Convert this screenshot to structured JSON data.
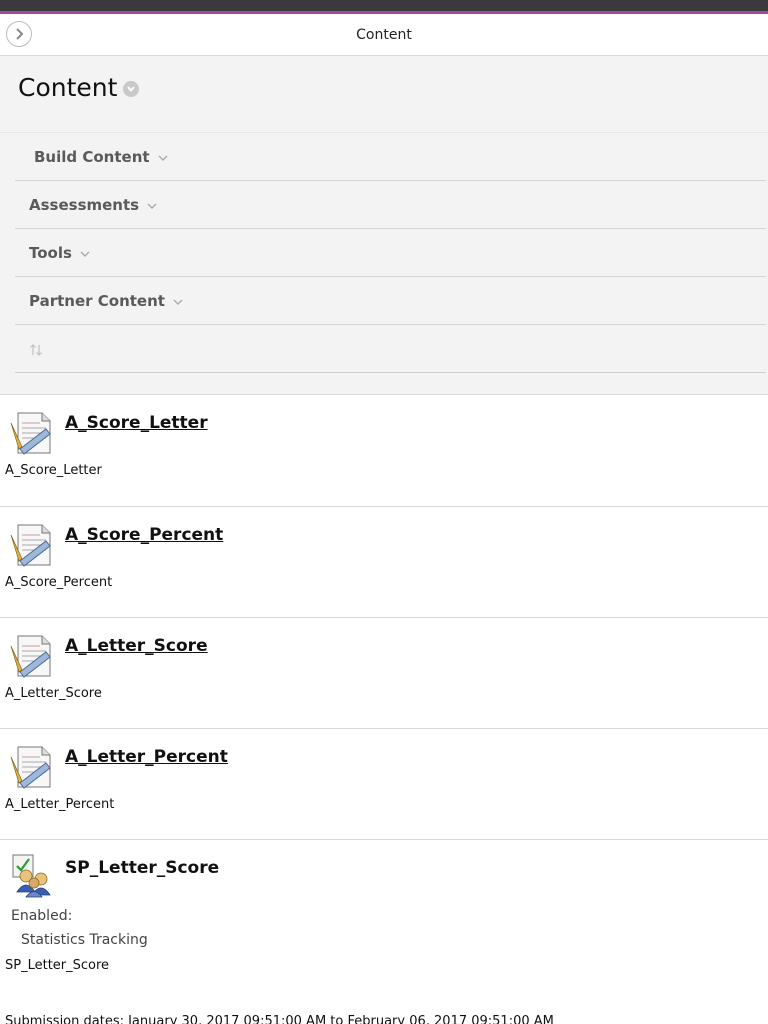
{
  "header": {
    "nav_title": "Content",
    "page_title": "Content"
  },
  "menu": {
    "items": [
      {
        "label": "Build Content"
      },
      {
        "label": "Assessments"
      },
      {
        "label": "Tools"
      },
      {
        "label": "Partner Content"
      }
    ]
  },
  "content_items": [
    {
      "title": "A_Score_Letter",
      "description": "A_Score_Letter",
      "icon": "assignment-icon"
    },
    {
      "title": "A_Score_Percent",
      "description": "A_Score_Percent",
      "icon": "assignment-icon"
    },
    {
      "title": "A_Letter_Score",
      "description": "A_Letter_Score",
      "icon": "assignment-icon"
    },
    {
      "title": "A_Letter_Percent",
      "description": "A_Letter_Percent",
      "icon": "assignment-icon"
    }
  ],
  "survey_item": {
    "title": "SP_Letter_Score",
    "icon": "self-peer-assessment-icon",
    "enabled_label": "Enabled:",
    "enabled_value": "Statistics Tracking",
    "description": "SP_Letter_Score",
    "submission_dates": "Submission dates: January 30, 2017 09:51:00 AM to February 06, 2017 09:51:00 AM"
  },
  "colors": {
    "topbar": "#3a393d",
    "accent": "#a24a9f",
    "panel_bg": "#f3f3f3"
  }
}
